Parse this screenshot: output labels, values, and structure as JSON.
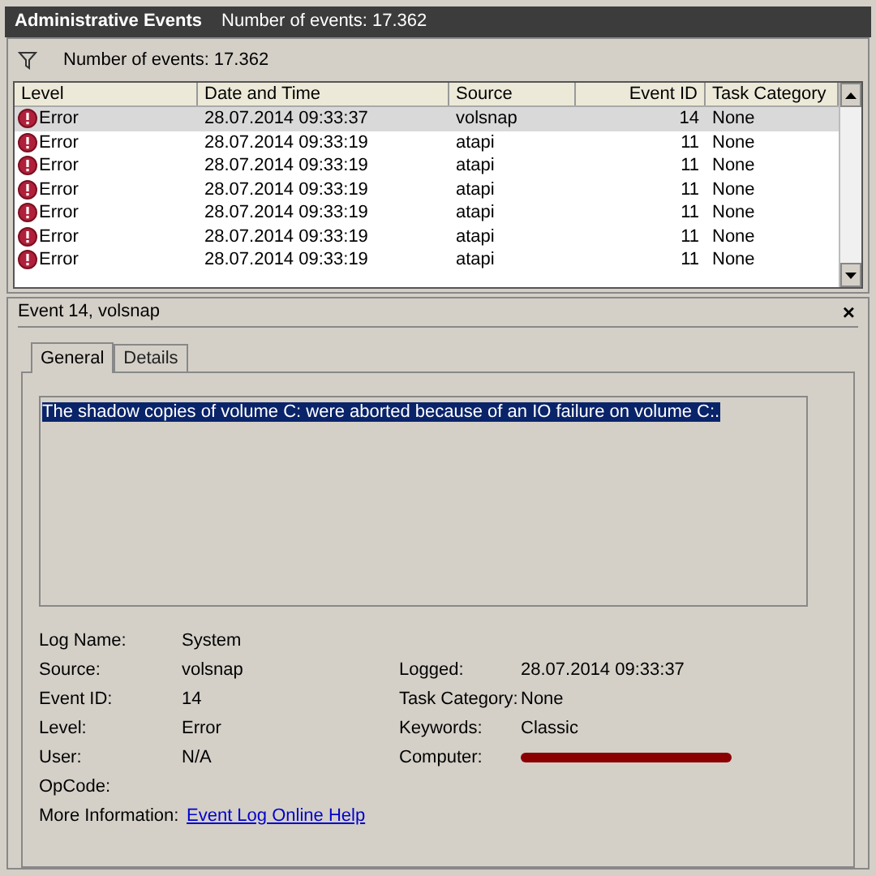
{
  "window": {
    "title": "Administrative Events",
    "subtitle": "Number of events: 17.362"
  },
  "filter_bar": {
    "label": "Number of events: 17.362"
  },
  "table": {
    "columns": [
      "Level",
      "Date and Time",
      "Source",
      "Event ID",
      "Task Category"
    ],
    "rows": [
      {
        "level": "Error",
        "date": "28.07.2014 09:33:37",
        "source": "volsnap",
        "event_id": "14",
        "task_category": "None",
        "selected": true
      },
      {
        "level": "Error",
        "date": "28.07.2014 09:33:19",
        "source": "atapi",
        "event_id": "11",
        "task_category": "None",
        "selected": false
      },
      {
        "level": "Error",
        "date": "28.07.2014 09:33:19",
        "source": "atapi",
        "event_id": "11",
        "task_category": "None",
        "selected": false
      },
      {
        "level": "Error",
        "date": "28.07.2014 09:33:19",
        "source": "atapi",
        "event_id": "11",
        "task_category": "None",
        "selected": false
      },
      {
        "level": "Error",
        "date": "28.07.2014 09:33:19",
        "source": "atapi",
        "event_id": "11",
        "task_category": "None",
        "selected": false
      },
      {
        "level": "Error",
        "date": "28.07.2014 09:33:19",
        "source": "atapi",
        "event_id": "11",
        "task_category": "None",
        "selected": false
      },
      {
        "level": "Error",
        "date": "28.07.2014 09:33:19",
        "source": "atapi",
        "event_id": "11",
        "task_category": "None",
        "selected": false
      }
    ]
  },
  "detail": {
    "title": "Event 14, volsnap",
    "close": "×",
    "tabs": [
      {
        "label": "General",
        "selected": true
      },
      {
        "label": "Details",
        "selected": false
      }
    ],
    "message": "The shadow copies of volume C: were aborted because of an IO failure on volume C:.",
    "fields_left": [
      {
        "label": "Log Name:",
        "value": "System"
      },
      {
        "label": "Source:",
        "value": "volsnap"
      },
      {
        "label": "Event ID:",
        "value": "14"
      },
      {
        "label": "Level:",
        "value": "Error"
      },
      {
        "label": "User:",
        "value": "N/A"
      },
      {
        "label": "OpCode:"
      },
      {
        "label": "More Information:",
        "value": "Event Log Online Help",
        "kind": "link"
      }
    ],
    "fields_right": [
      {
        "label": "Logged:",
        "value": "28.07.2014 09:33:37"
      },
      {
        "label": "Task Category:",
        "value": "None"
      },
      {
        "label": "Keywords:",
        "value": "Classic"
      },
      {
        "label": "Computer:",
        "kind": "redacted"
      }
    ]
  }
}
